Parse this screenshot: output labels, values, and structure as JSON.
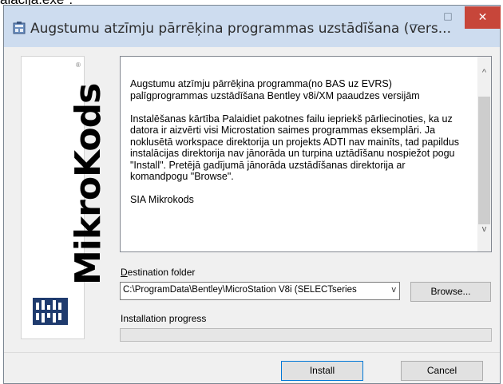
{
  "background_text": "alacija.exe\".",
  "window": {
    "title": "Augstumu atzīmju pārrēķina programmas uzstādīšana (vers...",
    "controls": {
      "minimize": "−",
      "maximize": "□",
      "close": "✕"
    }
  },
  "logo": {
    "word": "MikroKods",
    "reg": "®"
  },
  "description": {
    "paragraphs": [
      "Augstumu atzīmju pārrēķina programma(no BAS uz EVRS) palīgprogrammas uzstādīšana Bentley v8i/XM paaudzes versijām",
      "Instalēšanas kārtība Palaidiet pakotnes failu iepriekš pārliecinoties, ka uz datora ir aizvērti visi Microstation saimes programmas eksemplāri. Ja noklusētā workspace direktorija un projekts ADTI nav mainīts, tad papildus instalācijas direktorija nav jānorāda un turpina uztādīšanu nospiežot pogu \"Install\". Pretējā gadījumā jānorāda uzstādīšanas direktorija ar komandpogu \"Browse\".",
      "SIA Mikrokods"
    ],
    "scroll_up": "^",
    "scroll_down": "v"
  },
  "destination": {
    "label_first": "D",
    "label_rest": "estination folder",
    "value": "C:\\ProgramData\\Bentley\\MicroStation V8i (SELECTseries",
    "arrow": "v"
  },
  "browse_button": "Browse...",
  "progress": {
    "label": "Installation progress",
    "value": 0
  },
  "buttons": {
    "install": "Install",
    "cancel": "Cancel"
  },
  "colors": {
    "title_bar": "#cddcef",
    "close_button": "#c7463a",
    "focus_border": "#0078d7"
  }
}
